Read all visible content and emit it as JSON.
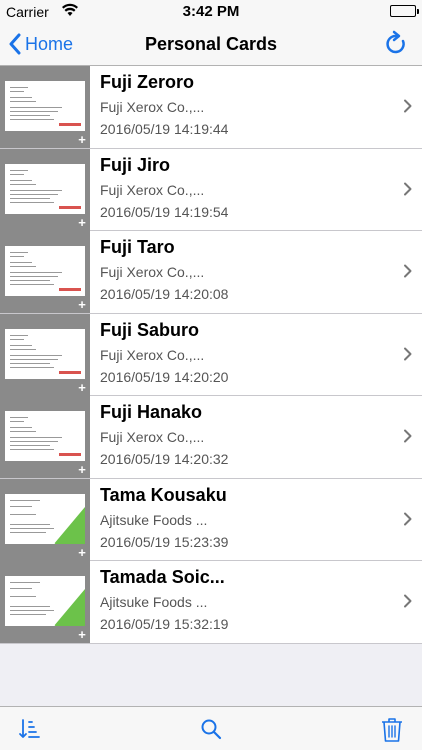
{
  "status_bar": {
    "carrier": "Carrier",
    "time": "3:42 PM"
  },
  "navbar": {
    "back_label": "Home",
    "title": "Personal Cards"
  },
  "cards": [
    {
      "name": "Fuji Zeroro",
      "company": "Fuji Xerox Co.,...",
      "date": "2016/05/19 14:19:44",
      "style": "xerox"
    },
    {
      "name": "Fuji Jiro",
      "company": "Fuji Xerox Co.,...",
      "date": "2016/05/19 14:19:54",
      "style": "xerox"
    },
    {
      "name": "Fuji Taro",
      "company": "Fuji Xerox Co.,...",
      "date": "2016/05/19 14:20:08",
      "style": "xerox"
    },
    {
      "name": "Fuji Saburo",
      "company": "Fuji Xerox Co.,...",
      "date": "2016/05/19 14:20:20",
      "style": "xerox"
    },
    {
      "name": "Fuji Hanako",
      "company": "Fuji Xerox Co.,...",
      "date": "2016/05/19 14:20:32",
      "style": "xerox"
    },
    {
      "name": "Tama Kousaku",
      "company": "Ajitsuke Foods ...",
      "date": "2016/05/19 15:23:39",
      "style": "foods"
    },
    {
      "name": "Tamada Soic...",
      "company": "Ajitsuke Foods ...",
      "date": "2016/05/19 15:32:19",
      "style": "foods"
    }
  ],
  "toolbar": {
    "sort_icon": "sort-icon",
    "search_icon": "search-icon",
    "trash_icon": "trash-icon"
  },
  "colors": {
    "accent": "#1a73e8",
    "xerox_logo": "#d9534f",
    "foods_stripe": "#6cc24a"
  }
}
